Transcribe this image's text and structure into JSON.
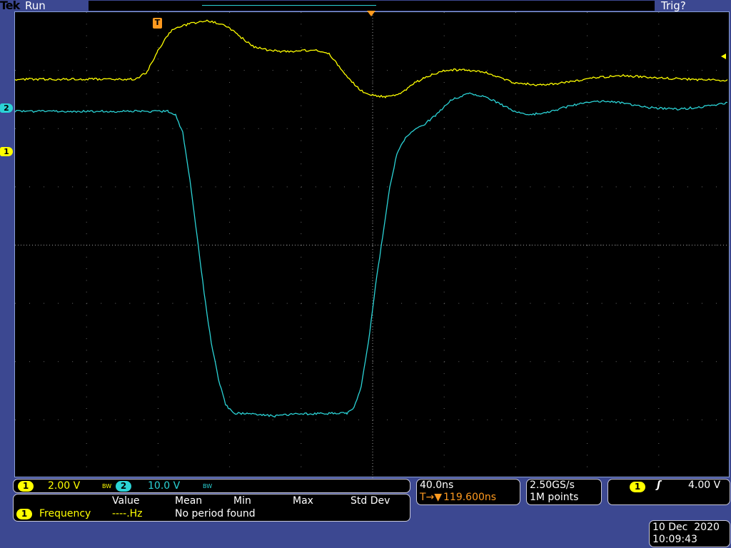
{
  "header": {
    "brand": "Tek",
    "state": "Run",
    "trigger_status": "Trig?"
  },
  "channels": [
    {
      "id": "1",
      "scale": "2.00 V",
      "bw": "BW",
      "color": "#ffff00"
    },
    {
      "id": "2",
      "scale": "10.0 V",
      "bw": "BW",
      "color": "#2bd3d6"
    }
  ],
  "markers": {
    "ch1": "1",
    "ch2": "2",
    "trigger": "T"
  },
  "measurements": {
    "headers": [
      "Value",
      "Mean",
      "Min",
      "Max",
      "Std Dev"
    ],
    "source": "1",
    "name": "Frequency",
    "value": "----.Hz",
    "status": "No period found"
  },
  "timebase": {
    "scale": "40.0ns",
    "delay_prefix": "T→▼",
    "delay": "119.600ns"
  },
  "acquisition": {
    "rate": "2.50GS/s",
    "points": "1M points"
  },
  "trigger": {
    "source": "1",
    "slope": "ʃ",
    "level": "4.00 V"
  },
  "datetime": {
    "date": "10 Dec  2020",
    "time": "10:09:43"
  }
}
